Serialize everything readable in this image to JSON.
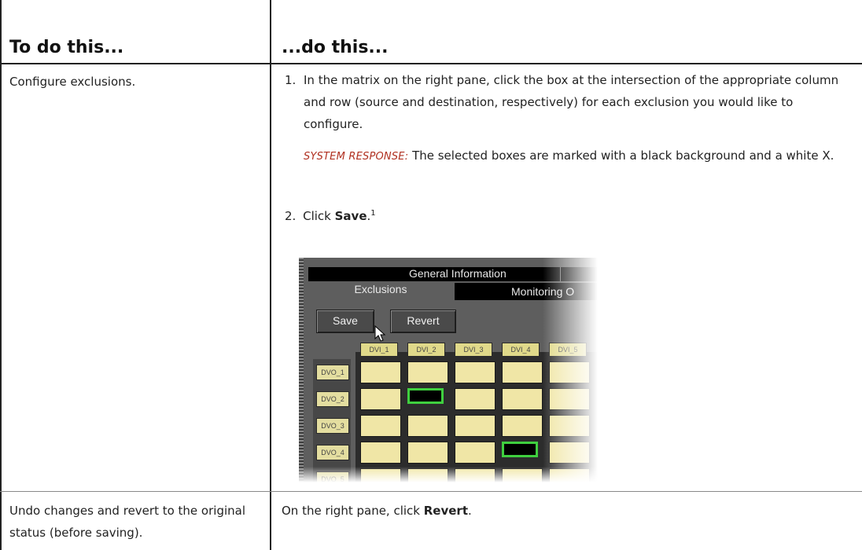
{
  "header": {
    "col1": "To do this...",
    "col2": "...do this..."
  },
  "rows": [
    {
      "task": "Configure exclusions.",
      "steps": [
        {
          "num": "1.",
          "text": "In the matrix on the right pane, click the box at the intersection of the appropriate column and row (source and destination, respectively) for each exclusion you would like to configure."
        },
        {
          "num": "2.",
          "text_pre": "Click ",
          "bold": "Save",
          "text_post": ".",
          "sup": "1"
        }
      ],
      "response_label": "SYSTEM RESPONSE:",
      "response_text": "The selected boxes are marked with a black background and a white X."
    },
    {
      "task": "Undo changes and revert to the original status (before saving).",
      "text_pre": "On the right pane, click ",
      "bold": "Revert",
      "text_post": "."
    }
  ],
  "screenshot": {
    "general_info": "General Information",
    "tab_exclusions": "Exclusions",
    "tab_monitoring": "Monitoring O",
    "save_button": "Save",
    "revert_button": "Revert",
    "columns": [
      "DVI_1",
      "DVI_2",
      "DVI_3",
      "DVI_4",
      "DVI_5"
    ],
    "rows": [
      "DVO_1",
      "DVO_2",
      "DVO_3",
      "DVO_4",
      "DVO_5"
    ],
    "selected": [
      [
        1,
        1
      ],
      [
        3,
        3
      ]
    ],
    "colors": {
      "box": "#f0e6a6",
      "selected_border": "#3fcf3f",
      "panel": "#5e5e5e"
    }
  }
}
